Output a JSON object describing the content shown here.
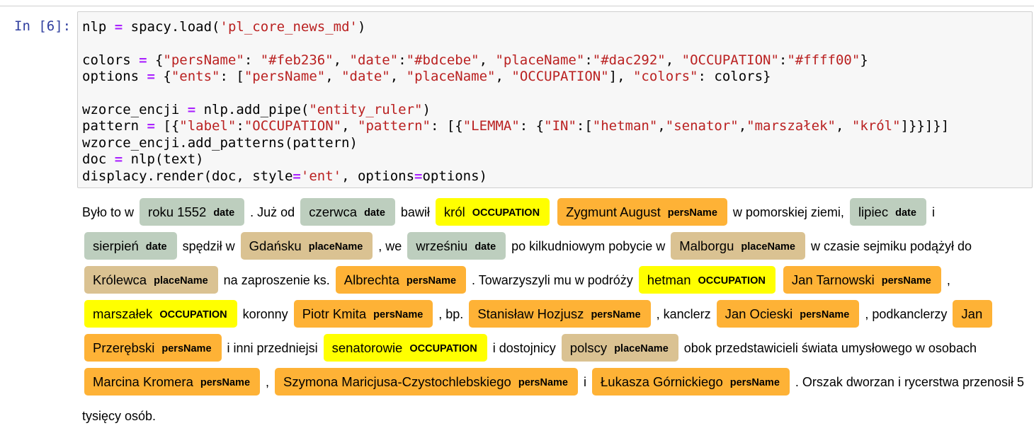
{
  "prompt": "In [6]:",
  "colors": {
    "persName": "#feb236",
    "date": "#bdcebe",
    "placeName": "#dac292",
    "OCCUPATION": "#ffff00"
  },
  "code_lines": [
    [
      [
        "t",
        "nlp "
      ],
      [
        "o",
        "="
      ],
      [
        "t",
        " spacy.load("
      ],
      [
        "s",
        "'pl_core_news_md'"
      ],
      [
        "t",
        ")"
      ]
    ],
    [],
    [
      [
        "t",
        "colors "
      ],
      [
        "o",
        "="
      ],
      [
        "t",
        " {"
      ],
      [
        "s",
        "\"persName\""
      ],
      [
        "t",
        ": "
      ],
      [
        "s",
        "\"#feb236\""
      ],
      [
        "t",
        ", "
      ],
      [
        "s",
        "\"date\""
      ],
      [
        "t",
        ":"
      ],
      [
        "s",
        "\"#bdcebe\""
      ],
      [
        "t",
        ", "
      ],
      [
        "s",
        "\"placeName\""
      ],
      [
        "t",
        ":"
      ],
      [
        "s",
        "\"#dac292\""
      ],
      [
        "t",
        ", "
      ],
      [
        "s",
        "\"OCCUPATION\""
      ],
      [
        "t",
        ":"
      ],
      [
        "s",
        "\"#ffff00\""
      ],
      [
        "t",
        "}"
      ]
    ],
    [
      [
        "t",
        "options "
      ],
      [
        "o",
        "="
      ],
      [
        "t",
        " {"
      ],
      [
        "s",
        "\"ents\""
      ],
      [
        "t",
        ": ["
      ],
      [
        "s",
        "\"persName\""
      ],
      [
        "t",
        ", "
      ],
      [
        "s",
        "\"date\""
      ],
      [
        "t",
        ", "
      ],
      [
        "s",
        "\"placeName\""
      ],
      [
        "t",
        ", "
      ],
      [
        "s",
        "\"OCCUPATION\""
      ],
      [
        "t",
        "], "
      ],
      [
        "s",
        "\"colors\""
      ],
      [
        "t",
        ": colors}"
      ]
    ],
    [],
    [
      [
        "t",
        "wzorce_encji "
      ],
      [
        "o",
        "="
      ],
      [
        "t",
        " nlp.add_pipe("
      ],
      [
        "s",
        "\"entity_ruler\""
      ],
      [
        "t",
        ")"
      ]
    ],
    [
      [
        "t",
        "pattern "
      ],
      [
        "o",
        "="
      ],
      [
        "t",
        " [{"
      ],
      [
        "s",
        "\"label\""
      ],
      [
        "t",
        ":"
      ],
      [
        "s",
        "\"OCCUPATION\""
      ],
      [
        "t",
        ", "
      ],
      [
        "s",
        "\"pattern\""
      ],
      [
        "t",
        ": [{"
      ],
      [
        "s",
        "\"LEMMA\""
      ],
      [
        "t",
        ": {"
      ],
      [
        "s",
        "\"IN\""
      ],
      [
        "t",
        ":["
      ],
      [
        "s",
        "\"hetman\""
      ],
      [
        "t",
        ","
      ],
      [
        "s",
        "\"senator\""
      ],
      [
        "t",
        ","
      ],
      [
        "s",
        "\"marszałek\""
      ],
      [
        "t",
        ", "
      ],
      [
        "s",
        "\"król\""
      ],
      [
        "t",
        "]}}]}]"
      ]
    ],
    [
      [
        "t",
        "wzorce_encji.add_patterns(pattern)"
      ]
    ],
    [
      [
        "t",
        "doc "
      ],
      [
        "o",
        "="
      ],
      [
        "t",
        " nlp(text)"
      ]
    ],
    [
      [
        "t",
        "displacy.render(doc, style"
      ],
      [
        "o",
        "="
      ],
      [
        "s",
        "'ent'"
      ],
      [
        "t",
        ", options"
      ],
      [
        "o",
        "="
      ],
      [
        "t",
        "options)"
      ]
    ]
  ],
  "output_segments": [
    {
      "text": "Było to w "
    },
    {
      "text": "roku 1552",
      "label": "date"
    },
    {
      "text": " . Już od "
    },
    {
      "text": "czerwca",
      "label": "date"
    },
    {
      "text": " bawił "
    },
    {
      "text": "król",
      "label": "OCCUPATION"
    },
    {
      "text": " "
    },
    {
      "text": "Zygmunt August",
      "label": "persName"
    },
    {
      "text": " w pomorskiej ziemi, "
    },
    {
      "text": "lipiec",
      "label": "date"
    },
    {
      "text": " i "
    },
    {
      "text": "sierpień",
      "label": "date"
    },
    {
      "text": " spędził w "
    },
    {
      "text": "Gdańsku",
      "label": "placeName"
    },
    {
      "text": " , we "
    },
    {
      "text": "wrześniu",
      "label": "date"
    },
    {
      "text": " po kilkudniowym pobycie w "
    },
    {
      "text": "Malborgu",
      "label": "placeName"
    },
    {
      "text": " w czasie sejmiku podążył do "
    },
    {
      "text": "Królewca",
      "label": "placeName"
    },
    {
      "text": " na zaproszenie ks. "
    },
    {
      "text": "Albrechta",
      "label": "persName"
    },
    {
      "text": " . Towarzyszyli mu w podróży "
    },
    {
      "text": "hetman",
      "label": "OCCUPATION"
    },
    {
      "text": " "
    },
    {
      "text": "Jan Tarnowski",
      "label": "persName"
    },
    {
      "text": " , "
    },
    {
      "text": "marszałek",
      "label": "OCCUPATION"
    },
    {
      "text": " koronny "
    },
    {
      "text": "Piotr Kmita",
      "label": "persName"
    },
    {
      "text": " , bp. "
    },
    {
      "text": "Stanisław Hozjusz",
      "label": "persName"
    },
    {
      "text": " , kanclerz "
    },
    {
      "text": "Jan Ocieski",
      "label": "persName"
    },
    {
      "text": " , podkanclerzy "
    },
    {
      "text": "Jan Przerębski",
      "label": "persName"
    },
    {
      "text": " i inni przedniejsi "
    },
    {
      "text": "senatorowie",
      "label": "OCCUPATION"
    },
    {
      "text": " i dostojnicy "
    },
    {
      "text": "polscy",
      "label": "placeName"
    },
    {
      "text": " obok przedstawicieli świata umysłowego w osobach "
    },
    {
      "text": "Marcina Kromera",
      "label": "persName"
    },
    {
      "text": " , "
    },
    {
      "text": "Szymona Maricjusa-Czystochlebskiego",
      "label": "persName"
    },
    {
      "text": " i "
    },
    {
      "text": "Łukasza Górnickiego",
      "label": "persName"
    },
    {
      "text": " . Orszak dworzan i rycerstwa przenosił 5 tysięcy osób."
    }
  ]
}
